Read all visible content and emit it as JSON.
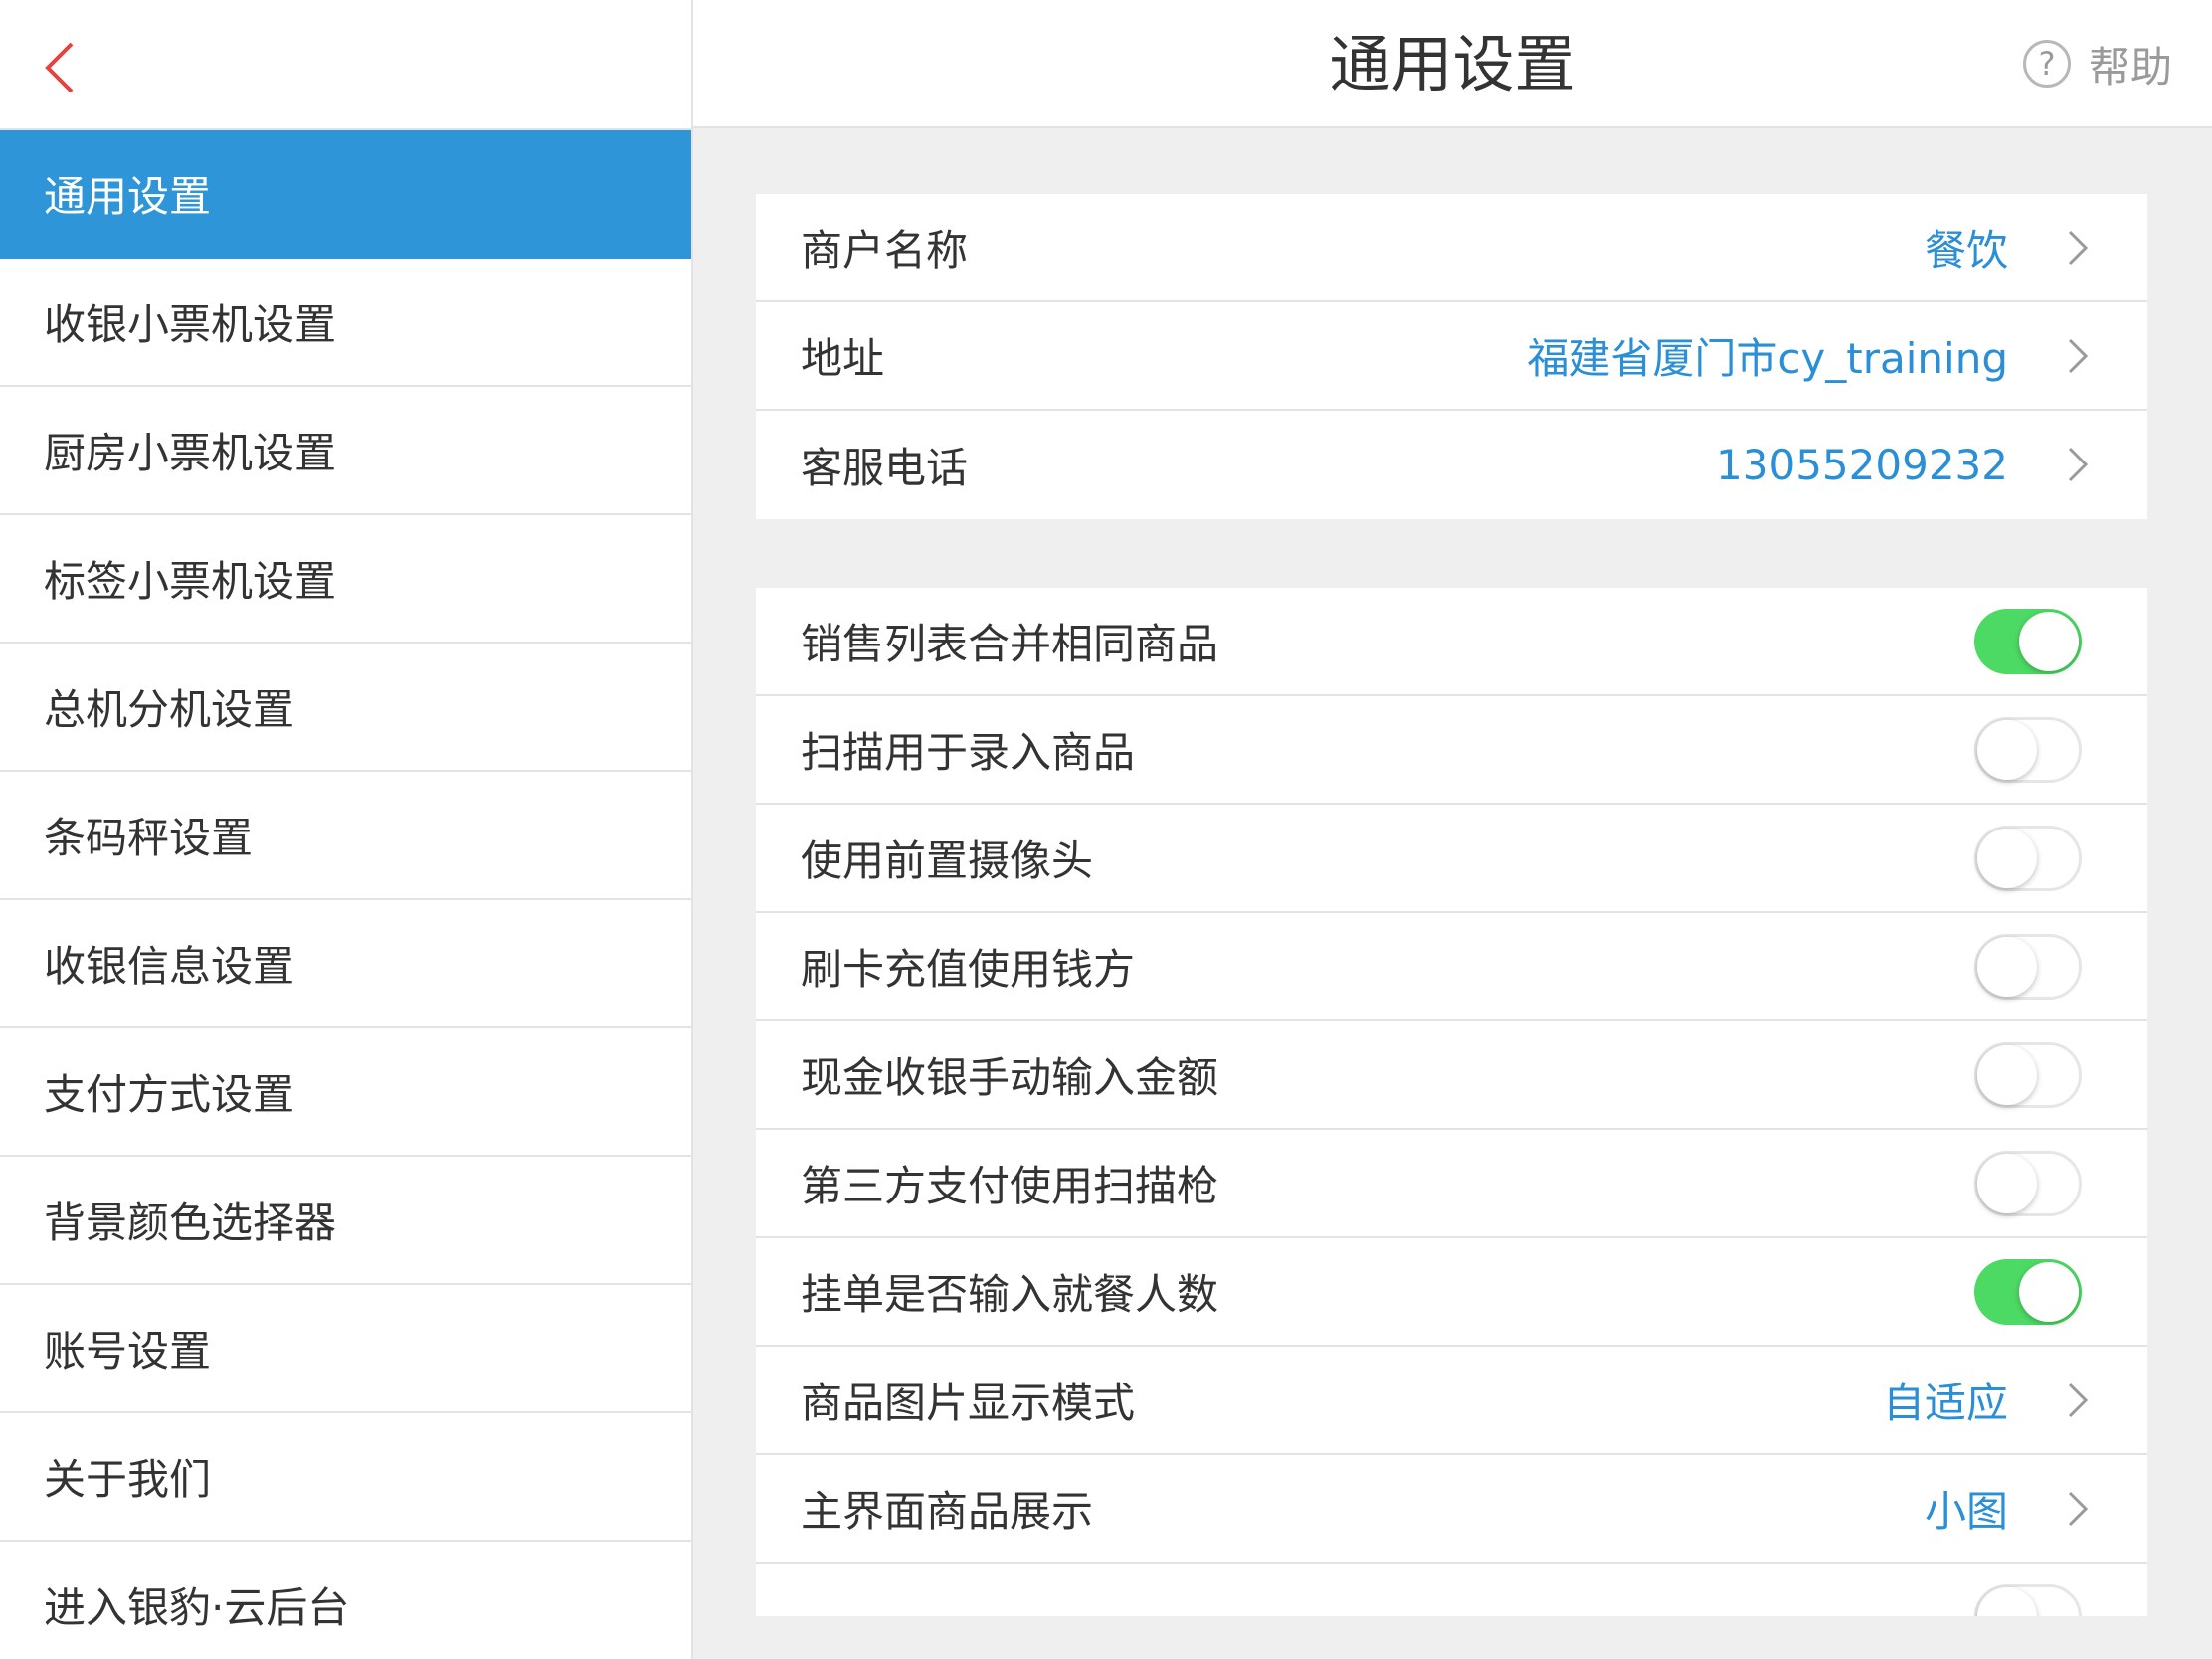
{
  "header": {
    "title": "通用设置",
    "help_label": "帮助",
    "help_icon_glyph": "?"
  },
  "sidebar": {
    "items": [
      {
        "label": "通用设置",
        "active": true
      },
      {
        "label": "收银小票机设置"
      },
      {
        "label": "厨房小票机设置"
      },
      {
        "label": "标签小票机设置"
      },
      {
        "label": "总机分机设置"
      },
      {
        "label": "条码秤设置"
      },
      {
        "label": "收银信息设置"
      },
      {
        "label": "支付方式设置"
      },
      {
        "label": "背景颜色选择器"
      },
      {
        "label": "账号设置"
      },
      {
        "label": "关于我们"
      },
      {
        "label": "进入银豹·云后台"
      }
    ]
  },
  "store_info": {
    "name_label": "商户名称",
    "name_value": "餐饮",
    "address_label": "地址",
    "address_value": "福建省厦门市cy_training",
    "phone_label": "客服电话",
    "phone_value": "13055209232"
  },
  "settings": {
    "merge_items_label": "销售列表合并相同商品",
    "merge_items_on": true,
    "scan_input_label": "扫描用于录入商品",
    "scan_input_on": false,
    "front_camera_label": "使用前置摄像头",
    "front_camera_on": false,
    "card_recharge_label": "刷卡充值使用钱方",
    "card_recharge_on": false,
    "cash_manual_label": "现金收银手动输入金额",
    "cash_manual_on": false,
    "third_party_scanner_label": "第三方支付使用扫描枪",
    "third_party_scanner_on": false,
    "hold_order_diners_label": "挂单是否输入就餐人数",
    "hold_order_diners_on": true,
    "image_mode_label": "商品图片显示模式",
    "image_mode_value": "自适应",
    "main_display_label": "主界面商品展示",
    "main_display_value": "小图"
  },
  "colors": {
    "accent": "#2e95d8",
    "value_blue": "#2a8fd6",
    "toggle_on": "#4cd964",
    "back_red": "#e64340"
  }
}
